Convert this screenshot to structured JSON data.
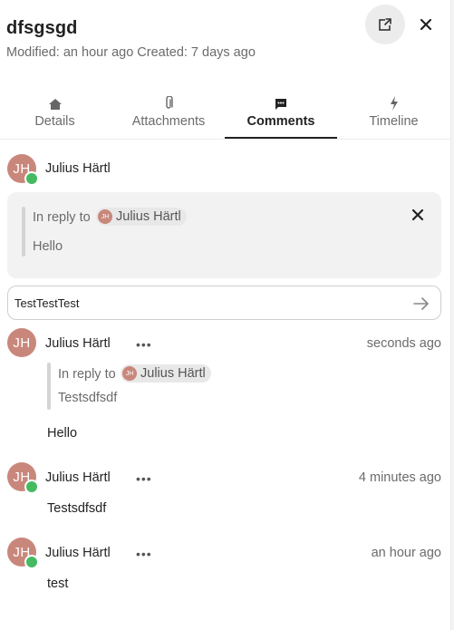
{
  "header": {
    "title": "dfsgsgd",
    "subtitle": "Modified: an hour ago Created: 7 days ago",
    "external_icon": "external-link-icon",
    "close_icon": "close-icon"
  },
  "tabs": [
    {
      "label": "Details",
      "icon": "home-icon"
    },
    {
      "label": "Attachments",
      "icon": "paperclip-icon"
    },
    {
      "label": "Comments",
      "icon": "comment-icon",
      "active": true
    },
    {
      "label": "Timeline",
      "icon": "lightning-icon"
    }
  ],
  "editor": {
    "author_initials": "JH",
    "author": "Julius Härtl",
    "reply_label": "In reply to",
    "reply_to_initials": "JH",
    "reply_to": "Julius Härtl",
    "reply_text": "Hello",
    "input_value": "TestTestTest"
  },
  "comments": [
    {
      "initials": "JH",
      "author": "Julius Härtl",
      "more": "•••",
      "time": "seconds ago",
      "reply_label": "In reply to",
      "reply_to_initials": "JH",
      "reply_to": "Julius Härtl",
      "reply_text": "Testsdfsdf",
      "text": "Hello",
      "online": false
    },
    {
      "initials": "JH",
      "author": "Julius Härtl",
      "more": "•••",
      "time": "4 minutes ago",
      "text": "Testsdfsdf",
      "online": true
    },
    {
      "initials": "JH",
      "author": "Julius Härtl",
      "more": "•••",
      "time": "an hour ago",
      "text": "test",
      "online": true
    }
  ],
  "colors": {
    "avatar": "#c9877c",
    "status_online": "#46ba61",
    "reply_background": "#f2f2f2"
  }
}
